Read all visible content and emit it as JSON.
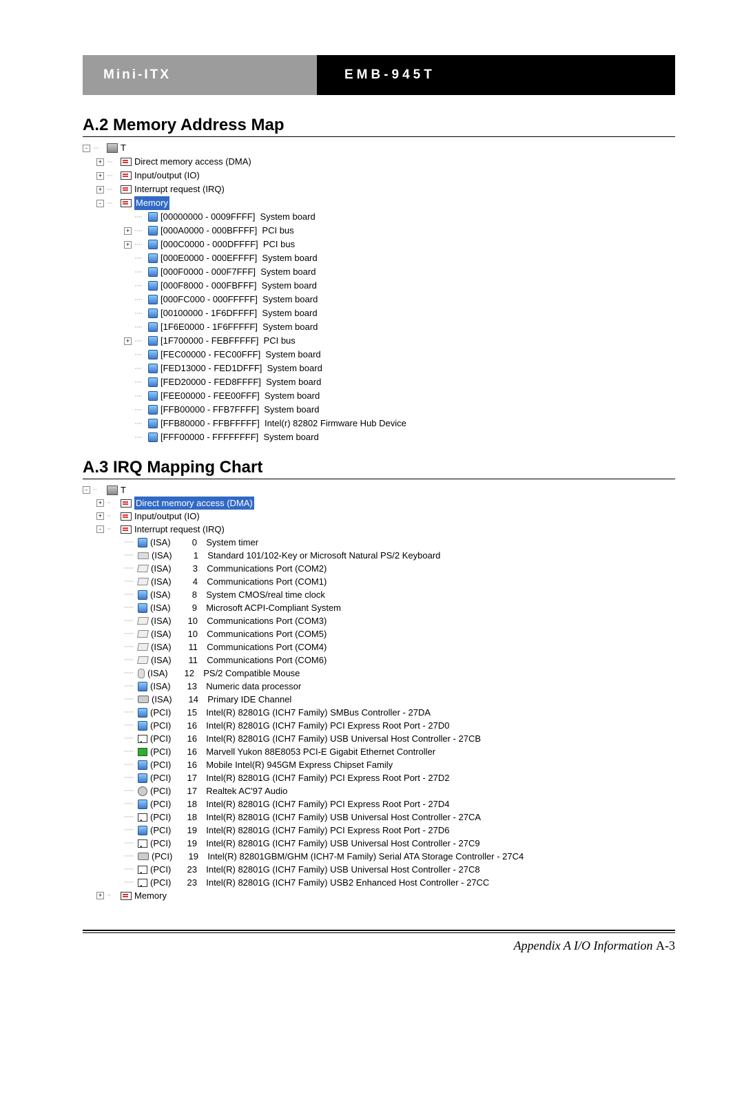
{
  "header": {
    "left": "Mini-ITX",
    "right": "EMB-945T"
  },
  "section1": {
    "title": "A.2 Memory Address Map",
    "root": "T",
    "categories": [
      {
        "exp": "+",
        "label": "Direct memory access (DMA)",
        "sel": false
      },
      {
        "exp": "+",
        "label": "Input/output (IO)",
        "sel": false
      },
      {
        "exp": "+",
        "label": "Interrupt request (IRQ)",
        "sel": false
      },
      {
        "exp": "-",
        "label": "Memory",
        "sel": true
      }
    ],
    "memory": [
      {
        "exp": "",
        "range": "[00000000 - 0009FFFF]",
        "dev": "System board"
      },
      {
        "exp": "+",
        "range": "[000A0000 - 000BFFFF]",
        "dev": "PCI bus"
      },
      {
        "exp": "+",
        "range": "[000C0000 - 000DFFFF]",
        "dev": "PCI bus"
      },
      {
        "exp": "",
        "range": "[000E0000 - 000EFFFF]",
        "dev": "System board"
      },
      {
        "exp": "",
        "range": "[000F0000 - 000F7FFF]",
        "dev": "System board"
      },
      {
        "exp": "",
        "range": "[000F8000 - 000FBFFF]",
        "dev": "System board"
      },
      {
        "exp": "",
        "range": "[000FC000 - 000FFFFF]",
        "dev": "System board"
      },
      {
        "exp": "",
        "range": "[00100000 - 1F6DFFFF]",
        "dev": "System board"
      },
      {
        "exp": "",
        "range": "[1F6E0000 - 1F6FFFFF]",
        "dev": "System board"
      },
      {
        "exp": "+",
        "range": "[1F700000 - FEBFFFFF]",
        "dev": "PCI bus"
      },
      {
        "exp": "",
        "range": "[FEC00000 - FEC00FFF]",
        "dev": "System board"
      },
      {
        "exp": "",
        "range": "[FED13000 - FED1DFFF]",
        "dev": "System board"
      },
      {
        "exp": "",
        "range": "[FED20000 - FED8FFFF]",
        "dev": "System board"
      },
      {
        "exp": "",
        "range": "[FEE00000 - FEE00FFF]",
        "dev": "System board"
      },
      {
        "exp": "",
        "range": "[FFB00000 - FFB7FFFF]",
        "dev": "System board"
      },
      {
        "exp": "",
        "range": "[FFB80000 - FFBFFFFF]",
        "dev": "Intel(r) 82802 Firmware Hub Device"
      },
      {
        "exp": "",
        "range": "[FFF00000 - FFFFFFFF]",
        "dev": "System board"
      }
    ]
  },
  "section2": {
    "title": "A.3 IRQ Mapping Chart",
    "root": "T",
    "categories": [
      {
        "exp": "+",
        "label": "Direct memory access (DMA)",
        "sel": true
      },
      {
        "exp": "+",
        "label": "Input/output (IO)",
        "sel": false
      },
      {
        "exp": "-",
        "label": "Interrupt request (IRQ)",
        "sel": false
      }
    ],
    "irq": [
      {
        "ico": "chip",
        "bus": "(ISA)",
        "num": "0",
        "dev": "System timer"
      },
      {
        "ico": "kbd",
        "bus": "(ISA)",
        "num": "1",
        "dev": "Standard 101/102-Key or Microsoft Natural PS/2 Keyboard"
      },
      {
        "ico": "com",
        "bus": "(ISA)",
        "num": "3",
        "dev": "Communications Port (COM2)"
      },
      {
        "ico": "com",
        "bus": "(ISA)",
        "num": "4",
        "dev": "Communications Port (COM1)"
      },
      {
        "ico": "chip",
        "bus": "(ISA)",
        "num": "8",
        "dev": "System CMOS/real time clock"
      },
      {
        "ico": "chip",
        "bus": "(ISA)",
        "num": "9",
        "dev": "Microsoft ACPI-Compliant System"
      },
      {
        "ico": "com",
        "bus": "(ISA)",
        "num": "10",
        "dev": "Communications Port (COM3)"
      },
      {
        "ico": "com",
        "bus": "(ISA)",
        "num": "10",
        "dev": "Communications Port (COM5)"
      },
      {
        "ico": "com",
        "bus": "(ISA)",
        "num": "11",
        "dev": "Communications Port (COM4)"
      },
      {
        "ico": "com",
        "bus": "(ISA)",
        "num": "11",
        "dev": "Communications Port (COM6)"
      },
      {
        "ico": "mouse",
        "bus": "(ISA)",
        "num": "12",
        "dev": "PS/2 Compatible Mouse"
      },
      {
        "ico": "chip",
        "bus": "(ISA)",
        "num": "13",
        "dev": "Numeric data processor"
      },
      {
        "ico": "disk",
        "bus": "(ISA)",
        "num": "14",
        "dev": "Primary IDE Channel"
      },
      {
        "ico": "chip",
        "bus": "(PCI)",
        "num": "15",
        "dev": "Intel(R) 82801G (ICH7 Family) SMBus Controller - 27DA"
      },
      {
        "ico": "chip",
        "bus": "(PCI)",
        "num": "16",
        "dev": "Intel(R) 82801G (ICH7 Family) PCI Express Root Port - 27D0"
      },
      {
        "ico": "usb",
        "bus": "(PCI)",
        "num": "16",
        "dev": "Intel(R) 82801G (ICH7 Family) USB Universal Host Controller - 27CB"
      },
      {
        "ico": "net",
        "bus": "(PCI)",
        "num": "16",
        "dev": "Marvell Yukon 88E8053 PCI-E Gigabit Ethernet Controller"
      },
      {
        "ico": "chip",
        "bus": "(PCI)",
        "num": "16",
        "dev": "Mobile Intel(R) 945GM Express Chipset Family"
      },
      {
        "ico": "chip",
        "bus": "(PCI)",
        "num": "17",
        "dev": "Intel(R) 82801G (ICH7 Family) PCI Express Root Port - 27D2"
      },
      {
        "ico": "audio",
        "bus": "(PCI)",
        "num": "17",
        "dev": "Realtek AC'97 Audio"
      },
      {
        "ico": "chip",
        "bus": "(PCI)",
        "num": "18",
        "dev": "Intel(R) 82801G (ICH7 Family) PCI Express Root Port - 27D4"
      },
      {
        "ico": "usb",
        "bus": "(PCI)",
        "num": "18",
        "dev": "Intel(R) 82801G (ICH7 Family) USB Universal Host Controller - 27CA"
      },
      {
        "ico": "chip",
        "bus": "(PCI)",
        "num": "19",
        "dev": "Intel(R) 82801G (ICH7 Family) PCI Express Root Port - 27D6"
      },
      {
        "ico": "usb",
        "bus": "(PCI)",
        "num": "19",
        "dev": "Intel(R) 82801G (ICH7 Family) USB Universal Host Controller - 27C9"
      },
      {
        "ico": "disk",
        "bus": "(PCI)",
        "num": "19",
        "dev": "Intel(R) 82801GBM/GHM (ICH7-M Family) Serial ATA Storage Controller - 27C4"
      },
      {
        "ico": "usb",
        "bus": "(PCI)",
        "num": "23",
        "dev": "Intel(R) 82801G (ICH7 Family) USB Universal Host Controller - 27C8"
      },
      {
        "ico": "usb",
        "bus": "(PCI)",
        "num": "23",
        "dev": "Intel(R) 82801G (ICH7 Family) USB2 Enhanced Host Controller - 27CC"
      }
    ],
    "lastCat": {
      "exp": "+",
      "label": "Memory"
    }
  },
  "footer": {
    "text": "Appendix A I/O Information",
    "page": "A-3"
  }
}
